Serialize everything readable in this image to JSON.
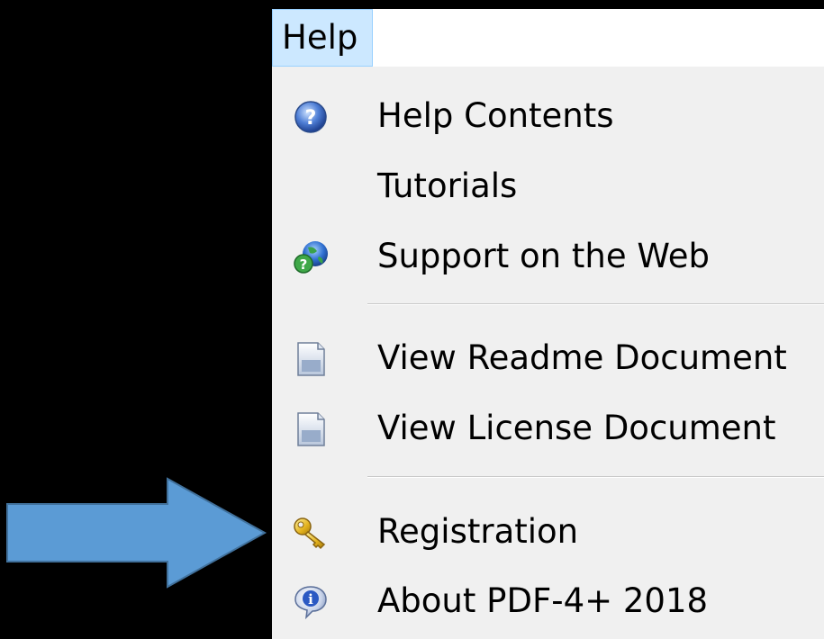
{
  "menubar": {
    "help_label": "Help"
  },
  "menu": {
    "items": [
      {
        "label": "Help Contents",
        "icon": "help-question-icon"
      },
      {
        "label": "Tutorials",
        "icon": ""
      },
      {
        "label": "Support on the Web",
        "icon": "web-support-globe-icon"
      },
      {
        "label": "View Readme Document",
        "icon": "document-icon"
      },
      {
        "label": "View License Document",
        "icon": "document-icon"
      },
      {
        "label": "Registration",
        "icon": "key-icon"
      },
      {
        "label": "About PDF-4+ 2018",
        "icon": "info-icon"
      }
    ]
  },
  "annotation": {
    "arrow_color": "#5b9bd5",
    "arrow_target": "Registration"
  },
  "colors": {
    "background": "#000000",
    "menu_background": "#f0f0f0",
    "menubar_highlight": "#cce8ff"
  }
}
